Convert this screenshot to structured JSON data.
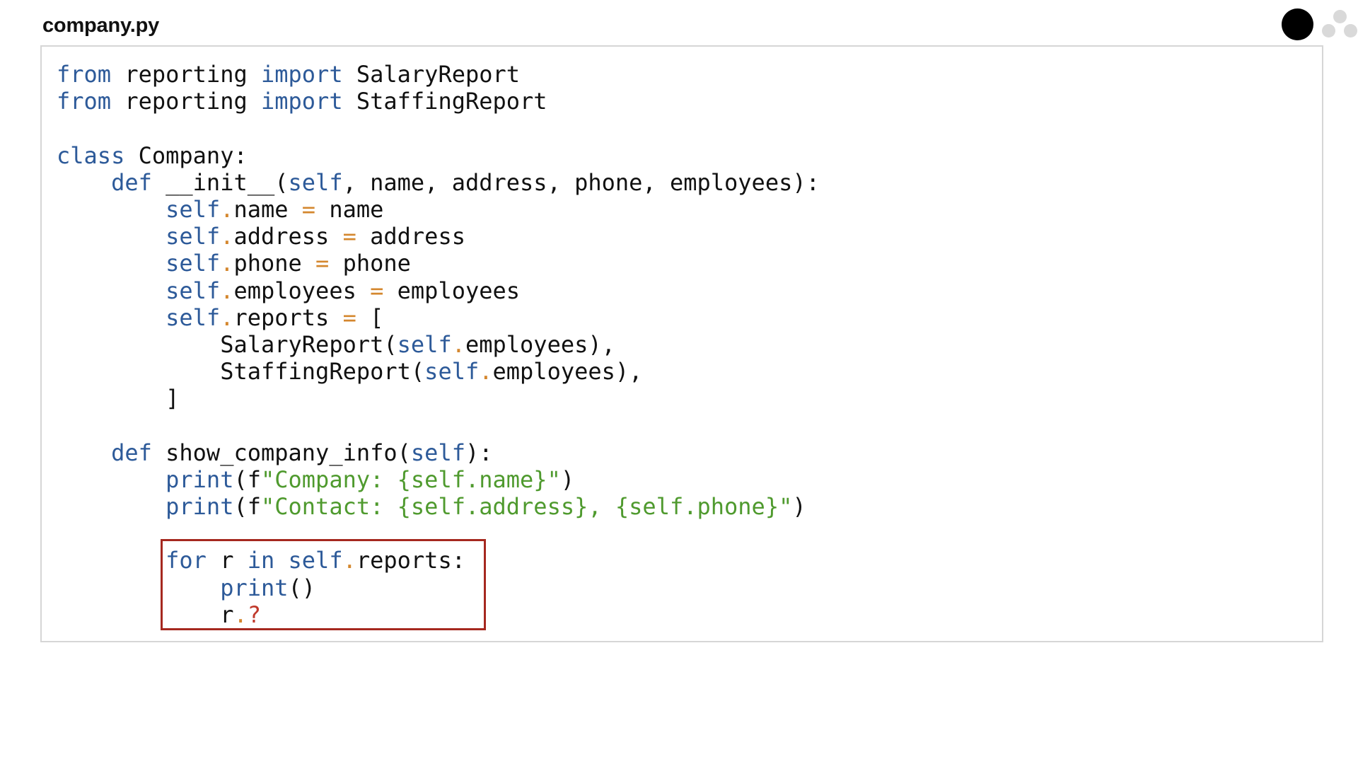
{
  "file": {
    "name": "company.py"
  },
  "code_lines": [
    [
      {
        "t": "from",
        "c": "kw"
      },
      {
        "t": " reporting ",
        "c": ""
      },
      {
        "t": "import",
        "c": "kw"
      },
      {
        "t": " SalaryReport",
        "c": ""
      }
    ],
    [
      {
        "t": "from",
        "c": "kw"
      },
      {
        "t": " reporting ",
        "c": ""
      },
      {
        "t": "import",
        "c": "kw"
      },
      {
        "t": " StaffingReport",
        "c": ""
      }
    ],
    [],
    [
      {
        "t": "class",
        "c": "kw"
      },
      {
        "t": " Company:",
        "c": ""
      }
    ],
    [
      {
        "t": "    ",
        "c": ""
      },
      {
        "t": "def",
        "c": "kw"
      },
      {
        "t": " __init__(",
        "c": ""
      },
      {
        "t": "self",
        "c": "kw"
      },
      {
        "t": ", name, address, phone, employees):",
        "c": ""
      }
    ],
    [
      {
        "t": "        ",
        "c": ""
      },
      {
        "t": "self",
        "c": "kw"
      },
      {
        "t": ".",
        "c": "op"
      },
      {
        "t": "name ",
        "c": ""
      },
      {
        "t": "=",
        "c": "op"
      },
      {
        "t": " name",
        "c": ""
      }
    ],
    [
      {
        "t": "        ",
        "c": ""
      },
      {
        "t": "self",
        "c": "kw"
      },
      {
        "t": ".",
        "c": "op"
      },
      {
        "t": "address ",
        "c": ""
      },
      {
        "t": "=",
        "c": "op"
      },
      {
        "t": " address",
        "c": ""
      }
    ],
    [
      {
        "t": "        ",
        "c": ""
      },
      {
        "t": "self",
        "c": "kw"
      },
      {
        "t": ".",
        "c": "op"
      },
      {
        "t": "phone ",
        "c": ""
      },
      {
        "t": "=",
        "c": "op"
      },
      {
        "t": " phone",
        "c": ""
      }
    ],
    [
      {
        "t": "        ",
        "c": ""
      },
      {
        "t": "self",
        "c": "kw"
      },
      {
        "t": ".",
        "c": "op"
      },
      {
        "t": "employees ",
        "c": ""
      },
      {
        "t": "=",
        "c": "op"
      },
      {
        "t": " employees",
        "c": ""
      }
    ],
    [
      {
        "t": "        ",
        "c": ""
      },
      {
        "t": "self",
        "c": "kw"
      },
      {
        "t": ".",
        "c": "op"
      },
      {
        "t": "reports ",
        "c": ""
      },
      {
        "t": "=",
        "c": "op"
      },
      {
        "t": " [",
        "c": ""
      }
    ],
    [
      {
        "t": "            SalaryReport(",
        "c": ""
      },
      {
        "t": "self",
        "c": "kw"
      },
      {
        "t": ".",
        "c": "op"
      },
      {
        "t": "employees),",
        "c": ""
      }
    ],
    [
      {
        "t": "            StaffingReport(",
        "c": ""
      },
      {
        "t": "self",
        "c": "kw"
      },
      {
        "t": ".",
        "c": "op"
      },
      {
        "t": "employees),",
        "c": ""
      }
    ],
    [
      {
        "t": "        ]",
        "c": ""
      }
    ],
    [],
    [
      {
        "t": "    ",
        "c": ""
      },
      {
        "t": "def",
        "c": "kw"
      },
      {
        "t": " show_company_info(",
        "c": ""
      },
      {
        "t": "self",
        "c": "kw"
      },
      {
        "t": "):",
        "c": ""
      }
    ],
    [
      {
        "t": "        ",
        "c": ""
      },
      {
        "t": "print",
        "c": "kw"
      },
      {
        "t": "(f",
        "c": ""
      },
      {
        "t": "\"Company: {self.name}\"",
        "c": "str"
      },
      {
        "t": ")",
        "c": ""
      }
    ],
    [
      {
        "t": "        ",
        "c": ""
      },
      {
        "t": "print",
        "c": "kw"
      },
      {
        "t": "(f",
        "c": ""
      },
      {
        "t": "\"Contact: {self.address}, {self.phone}\"",
        "c": "str"
      },
      {
        "t": ")",
        "c": ""
      }
    ],
    [],
    [
      {
        "t": "        ",
        "c": ""
      },
      {
        "t": "for",
        "c": "kw"
      },
      {
        "t": " r ",
        "c": ""
      },
      {
        "t": "in",
        "c": "kw"
      },
      {
        "t": " ",
        "c": ""
      },
      {
        "t": "self",
        "c": "kw"
      },
      {
        "t": ".",
        "c": "op"
      },
      {
        "t": "reports:",
        "c": ""
      }
    ],
    [
      {
        "t": "            ",
        "c": ""
      },
      {
        "t": "print",
        "c": "kw"
      },
      {
        "t": "()",
        "c": ""
      }
    ],
    [
      {
        "t": "            r",
        "c": ""
      },
      {
        "t": ".",
        "c": "op"
      },
      {
        "t": "?",
        "c": "q"
      }
    ]
  ],
  "colors": {
    "keyword": "#2d5a99",
    "operator": "#d4872e",
    "string": "#4f9a2e",
    "question_mark": "#c0392b",
    "highlight_border": "#a5281f",
    "panel_border": "#d6d6d6"
  }
}
